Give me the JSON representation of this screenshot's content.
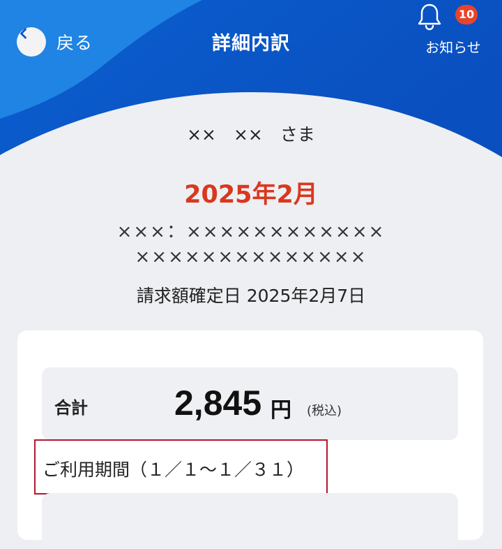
{
  "header": {
    "back_label": "戻る",
    "title": "詳細内訳",
    "notice_label": "お知らせ",
    "notice_count": "10",
    "colors": {
      "primary": "#0a56c9",
      "accent": "#1e7fdf",
      "badge": "#e8442c"
    }
  },
  "customer": {
    "name": "××　××　さま"
  },
  "billing": {
    "month": "2025年2月",
    "account_line1": "×××：××××××××××××",
    "account_line2": "××××××××××××××",
    "confirmed_date": "請求額確定日 2025年2月7日"
  },
  "summary": {
    "total_label": "合計",
    "total_amount": "2,845",
    "unit": "円",
    "tax_note": "(税込)",
    "period": "ご利用期間（１／１～１／３１）"
  }
}
